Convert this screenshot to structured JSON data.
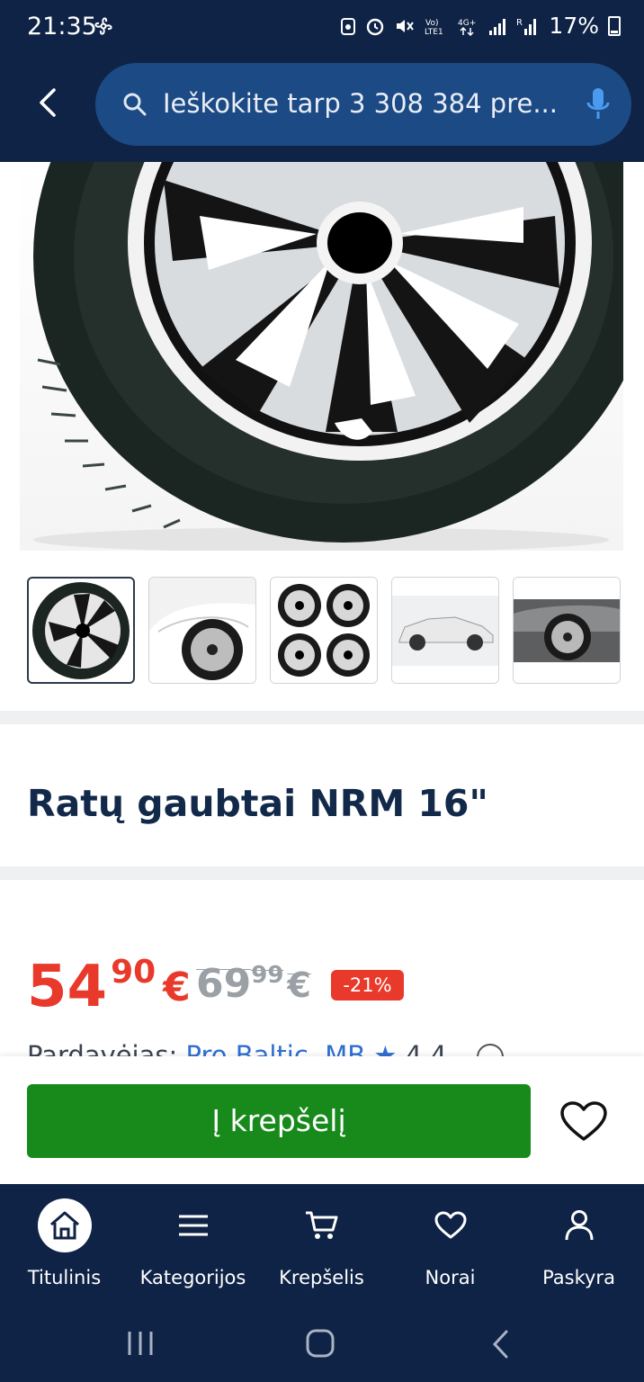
{
  "status_bar": {
    "time": "21:35",
    "battery_text": "17%"
  },
  "header": {
    "search_placeholder": "Ieškokite tarp 3 308 384 pre..."
  },
  "product": {
    "title": "Ratų gaubtai NRM 16\"",
    "thumbnails": [
      "wheel-cover-front",
      "car-wheel-closeup",
      "four-wheel-covers",
      "white-suv-side",
      "gray-car-front"
    ]
  },
  "price": {
    "current_int": "54",
    "current_dec": "90",
    "current_currency": "€",
    "old_int": "69",
    "old_dec": "99",
    "old_currency": "€",
    "discount": "-21%",
    "accent_color": "#e8392b"
  },
  "seller": {
    "label": "Pardavėjas:",
    "name": "Pro Baltic, MB",
    "rating": "4.4"
  },
  "actions": {
    "add_to_cart": "Į krepšelį"
  },
  "bottom_nav": {
    "items": [
      {
        "label": "Titulinis",
        "icon": "home-icon"
      },
      {
        "label": "Kategorijos",
        "icon": "menu-icon"
      },
      {
        "label": "Krepšelis",
        "icon": "cart-icon"
      },
      {
        "label": "Norai",
        "icon": "heart-icon"
      },
      {
        "label": "Paskyra",
        "icon": "user-icon"
      }
    ]
  },
  "colors": {
    "header_bg": "#0f2346",
    "search_bg": "#1c4a85",
    "cta_green": "#178a1b",
    "link_blue": "#2f6fd1"
  }
}
